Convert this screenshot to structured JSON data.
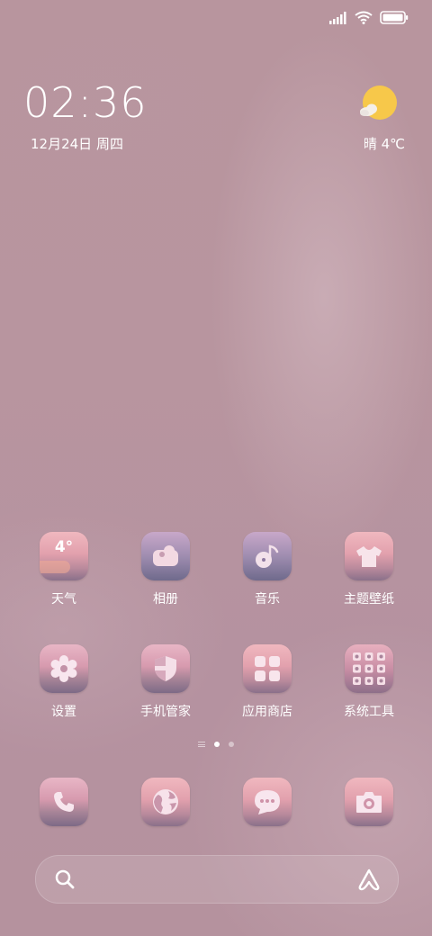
{
  "status": {
    "icons": [
      "signal-icon",
      "wifi-icon",
      "battery-icon"
    ]
  },
  "lockwidget": {
    "time": "02:36",
    "date": "12月24日 周四",
    "weather": "晴  4℃"
  },
  "apps_row1": [
    {
      "label": "天气",
      "icon": "weather-app-icon",
      "badge": "4°"
    },
    {
      "label": "相册",
      "icon": "gallery-app-icon"
    },
    {
      "label": "音乐",
      "icon": "music-app-icon"
    },
    {
      "label": "主题壁纸",
      "icon": "themes-app-icon"
    }
  ],
  "apps_row2": [
    {
      "label": "设置",
      "icon": "settings-app-icon"
    },
    {
      "label": "手机管家",
      "icon": "security-app-icon"
    },
    {
      "label": "应用商店",
      "icon": "app-store-icon"
    },
    {
      "label": "系统工具",
      "icon": "folder-icon"
    }
  ],
  "dock": [
    {
      "icon": "phone-icon"
    },
    {
      "icon": "browser-icon"
    },
    {
      "icon": "messages-icon"
    },
    {
      "icon": "camera-icon"
    }
  ],
  "pages": {
    "total": 2,
    "active": 1
  },
  "search": {
    "left_icon": "search-icon",
    "right_icon": "assistant-icon"
  }
}
